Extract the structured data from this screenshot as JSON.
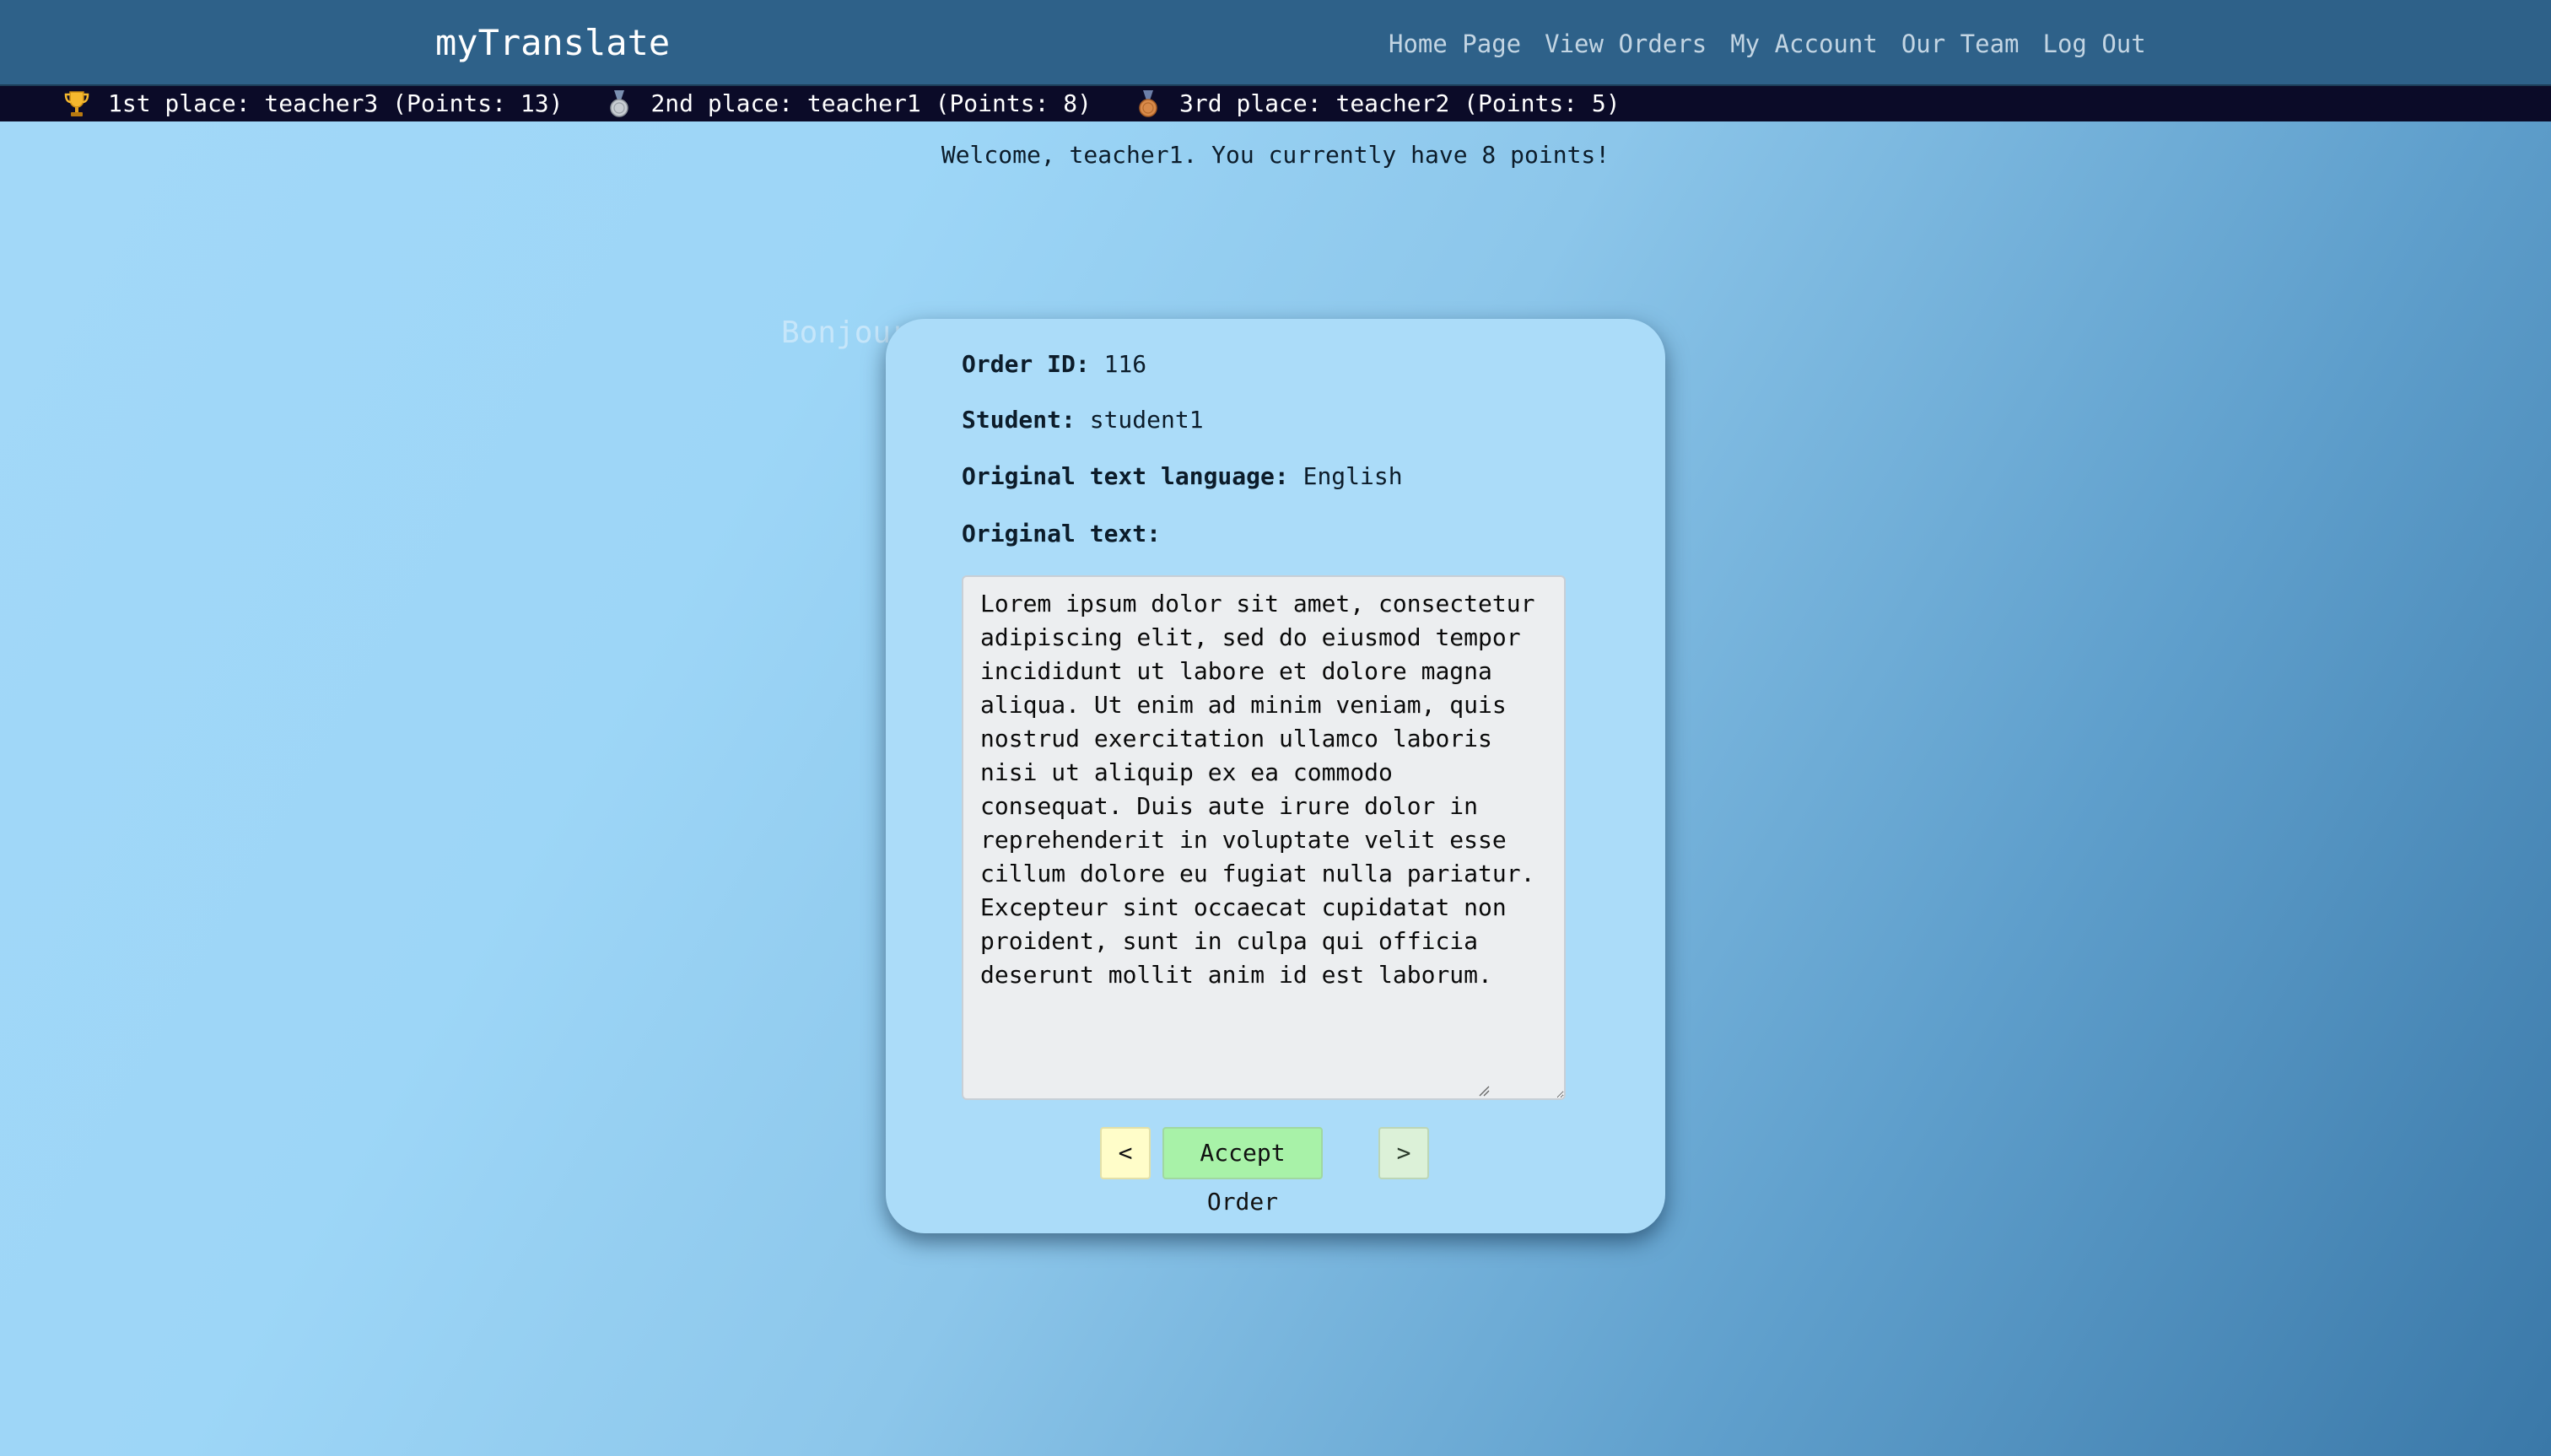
{
  "nav": {
    "brand": "myTranslate",
    "links": [
      "Home Page",
      "View Orders",
      "My Account",
      "Our Team",
      "Log Out"
    ]
  },
  "leaderboard": [
    {
      "icon": "trophy-icon",
      "text": "1st place: teacher3 (Points: 13)"
    },
    {
      "icon": "silver-medal-icon",
      "text": "2nd place: teacher1 (Points: 8)"
    },
    {
      "icon": "bronze-medal-icon",
      "text": "3rd place: teacher2 (Points: 5)"
    }
  ],
  "welcome": "Welcome, teacher1. You currently have 8 points!",
  "ghost_text": "Bonjour",
  "order": {
    "id_label": "Order ID:",
    "id_value": "116",
    "student_label": "Student:",
    "student_value": "student1",
    "language_label": "Original text language:",
    "language_value": "English",
    "text_label": "Original text:",
    "text_value": "Lorem ipsum dolor sit amet, consectetur adipiscing elit, sed do eiusmod tempor incididunt ut labore et dolore magna aliqua. Ut enim ad minim veniam, quis nostrud exercitation ullamco laboris nisi ut aliquip ex ea commodo consequat. Duis aute irure dolor in reprehenderit in voluptate velit esse cillum dolore eu fugiat nulla pariatur. Excepteur sint occaecat cupidatat non proident, sunt in culpa qui officia deserunt mollit anim id est laborum."
  },
  "buttons": {
    "prev": "<",
    "accept": "Accept Order",
    "next": ">"
  },
  "colors": {
    "navbar": "#2e6189",
    "leaderboard_bar": "#0b0b28",
    "card": "#abdcf9",
    "accept_button": "#a8f2a8",
    "prev_button": "#fffdc9",
    "next_button": "#dcf1d8"
  }
}
